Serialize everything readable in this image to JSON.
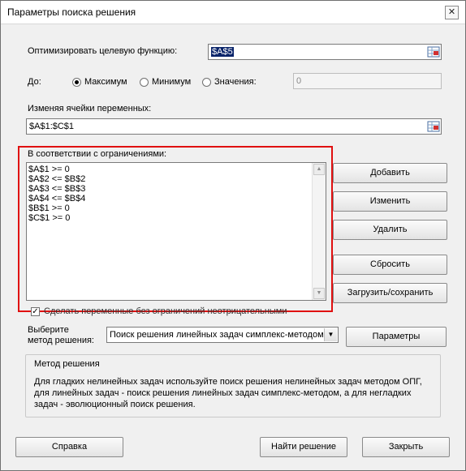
{
  "window": {
    "title": "Параметры поиска решения",
    "close_label": "✕"
  },
  "objective": {
    "label": "Оптимизировать целевую функцию:",
    "value": "$A$5"
  },
  "to": {
    "label": "До:",
    "options": [
      {
        "label": "Максимум",
        "checked": true
      },
      {
        "label": "Минимум",
        "checked": false
      },
      {
        "label": "Значения:",
        "checked": false
      }
    ],
    "value_field": "0"
  },
  "variables": {
    "label": "Изменяя ячейки переменных:",
    "value": "$A$1:$C$1"
  },
  "constraints": {
    "label": "В соответствии с ограничениями:",
    "items": [
      "$A$1 >= 0",
      "$A$2 <= $B$2",
      "$A$3 <= $B$3",
      "$A$4 <= $B$4",
      "$B$1 >= 0",
      "$C$1 >= 0"
    ]
  },
  "side_buttons": {
    "add": "Добавить",
    "change": "Изменить",
    "delete": "Удалить",
    "reset": "Сбросить",
    "load_save": "Загрузить/сохранить"
  },
  "nonneg": {
    "label": "Сделать переменные без ограничений неотрицательными",
    "checked": true
  },
  "method": {
    "label_line1": "Выберите",
    "label_line2": "метод решения:",
    "value": "Поиск решения линейных задач симплекс-методом",
    "params_button": "Параметры"
  },
  "method_desc": {
    "title": "Метод решения",
    "text": "Для гладких нелинейных задач используйте поиск решения нелинейных задач методом ОПГ, для линейных задач - поиск решения линейных задач симплекс-методом, а для негладких задач - эволюционный поиск решения."
  },
  "footer": {
    "help": "Справка",
    "solve": "Найти решение",
    "close": "Закрыть"
  },
  "colors": {
    "highlight_border": "#e01010",
    "selection": "#0a246a"
  }
}
